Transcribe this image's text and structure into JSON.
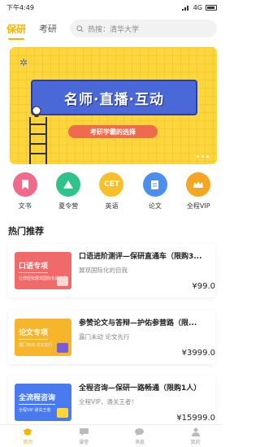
{
  "status_bar": {
    "time": "下午4:49",
    "network": "4G"
  },
  "header": {
    "tabs": [
      {
        "label": "保研"
      },
      {
        "label": "考研"
      }
    ],
    "search": {
      "placeholder": "热搜：清华大学"
    }
  },
  "banner": {
    "headline": "名师·直播·互动",
    "tagline": "考研学霸的选择"
  },
  "categories": [
    {
      "label": "文书",
      "color": "#f06a8a"
    },
    {
      "label": "夏令营",
      "color": "#2fc28a"
    },
    {
      "label": "英语",
      "icon_text": "CET",
      "color": "#f7c02b"
    },
    {
      "label": "论文",
      "color": "#4a8ef0"
    },
    {
      "label": "全程VIP",
      "color": "#f5a623"
    }
  ],
  "section": {
    "title": "热门推荐"
  },
  "courses": [
    {
      "title": "口语进阶测评—保研直通车（限购3...",
      "subtitle": "展现国际化的自我",
      "price": "¥99.0",
      "thumb_title": "口语专项",
      "thumb_sub": "让你轻松展现国际化的自我",
      "thumb_color": "#f06a6a"
    },
    {
      "title": "参赞论文与答辩—护佑参营路（限...",
      "subtitle": "露门未动 论文先行",
      "price": "¥3999.0",
      "thumb_title": "论文专项",
      "thumb_sub": "露门未动 论文先行",
      "thumb_color": "#f7b52b"
    },
    {
      "title": "全程咨询—保研一路畅通（限购1人）",
      "subtitle": "全程VIP，通关王者！",
      "price": "¥15999.0",
      "thumb_title": "全流程咨询",
      "thumb_sub": "全程VIP 通关王者",
      "thumb_color": "#4a7af0"
    }
  ],
  "tabbar": [
    {
      "label": "首页",
      "icon": "graduation-cap-icon"
    },
    {
      "label": "课堂",
      "icon": "chat-square-icon"
    },
    {
      "label": "消息",
      "icon": "message-bubble-icon"
    },
    {
      "label": "我的",
      "icon": "person-icon"
    }
  ],
  "colors": {
    "accent": "#f5b400",
    "banner_bg": "#ffd63a",
    "board": "#4a68d8"
  }
}
